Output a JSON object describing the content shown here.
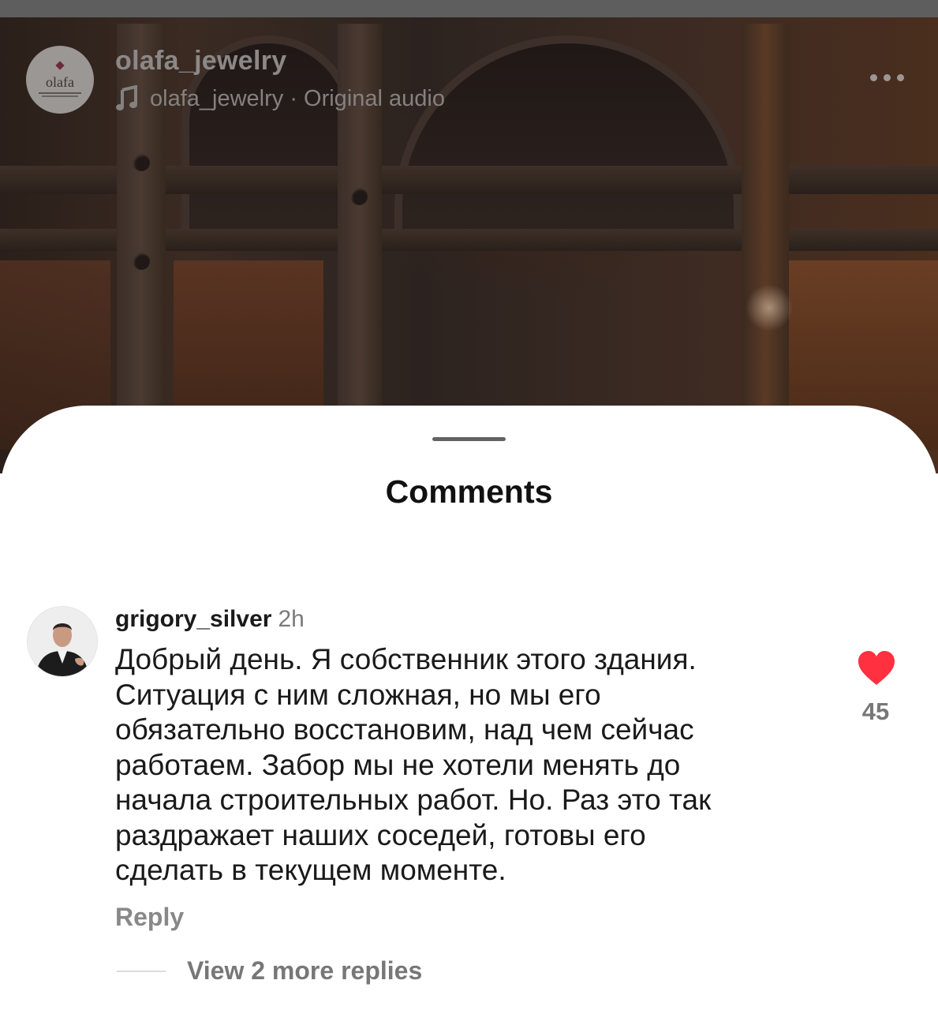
{
  "video": {
    "account": {
      "username": "olafa_jewelry",
      "avatar_text": "olafa"
    },
    "audio": {
      "label": "olafa_jewelry · Original audio",
      "icon": "music-note-icon"
    },
    "more_icon": "more-options-icon"
  },
  "comments_sheet": {
    "title": "Comments",
    "comments": [
      {
        "username": "grigory_silver",
        "time": "2h",
        "text": "Добрый день. Я собственник этого здания.\nСитуация с ним сложная, но мы его\nобязательно восстановим, над чем сейчас\nработаем. Забор мы не хотели менять до\nначала строительных работ. Но. Раз это так\nраздражает наших соседей, готовы его\nсделать в текущем моменте.",
        "likes": "45",
        "liked": true,
        "like_color": "#ff3040",
        "reply_label": "Reply",
        "view_replies_label": "View 2 more replies"
      }
    ]
  }
}
